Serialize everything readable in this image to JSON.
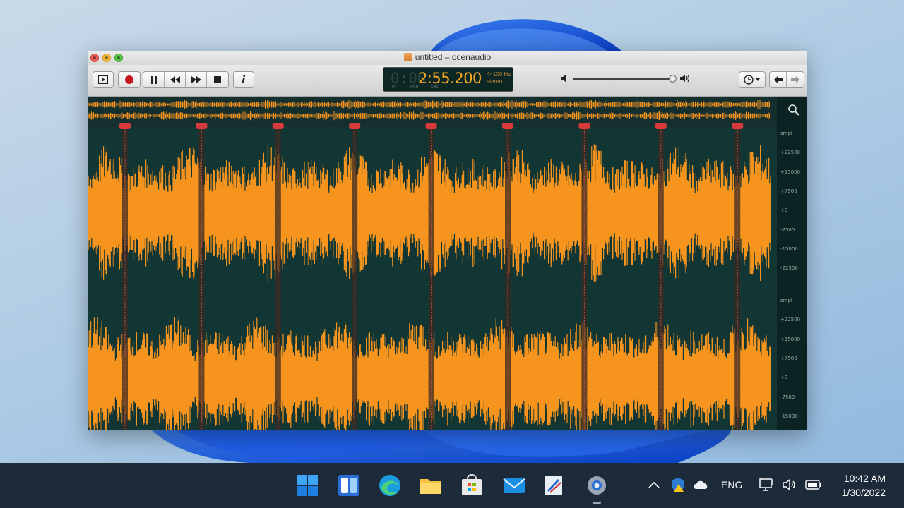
{
  "window": {
    "title": "untitled – ocenaudio",
    "toolbar": {
      "icons": [
        "play-selection-icon",
        "record-icon",
        "pause-icon",
        "rewind-icon",
        "fast-forward-icon",
        "stop-icon",
        "info-icon",
        "clock-icon",
        "back-arrow-icon",
        "forward-arrow-icon"
      ],
      "info_label": "i"
    },
    "display": {
      "ghost_digits": "0:00",
      "time": "2:55.200",
      "sample_rate": "44100 Hz",
      "channels": "stereo",
      "unit_hr": "hr",
      "unit_min": "min",
      "unit_sec": "sec"
    },
    "volume": {
      "level": 0.97
    },
    "markers": {
      "count": 9
    },
    "scale": {
      "top": [
        "smpl",
        "+22500",
        "+15000",
        "+7500",
        "+0",
        "-7500",
        "-15000",
        "-22500"
      ],
      "bottom": [
        "smpl",
        "+22500",
        "+15000",
        "+7500",
        "+0",
        "-7500",
        "-15000"
      ]
    }
  },
  "colors": {
    "waveform": "#f7941d",
    "background": "#0e2a29",
    "marker": "#d63a3a",
    "taskbar": "#1c2a3a"
  },
  "taskbar": {
    "apps": [
      "windows-start-icon",
      "widgets-icon",
      "edge-icon",
      "file-explorer-icon",
      "microsoft-store-icon",
      "mail-icon",
      "paint-icon",
      "settings-icon"
    ],
    "language": "ENG",
    "time": "10:42 AM",
    "date": "1/30/2022"
  }
}
